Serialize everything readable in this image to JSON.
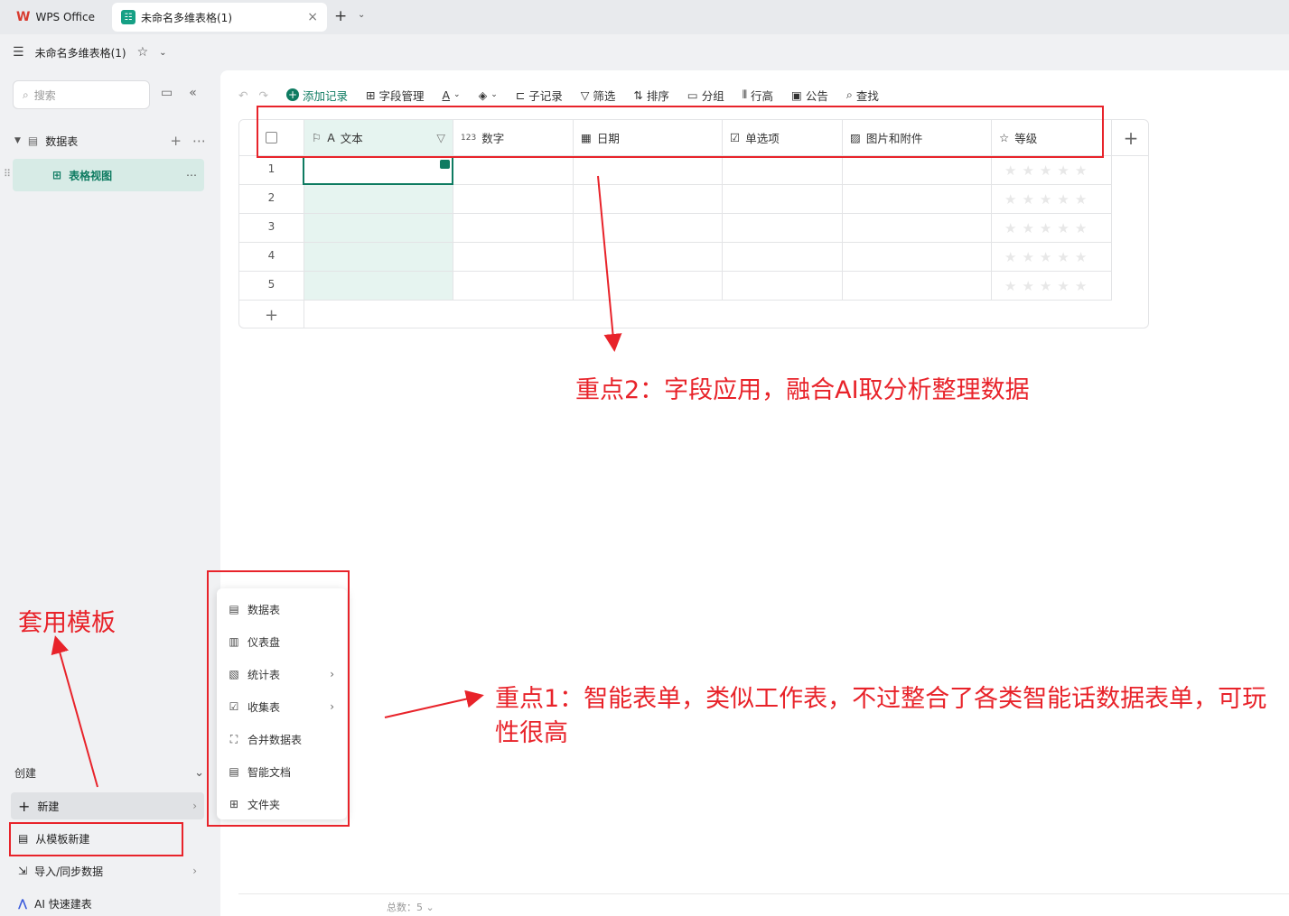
{
  "tabs": {
    "wps_label": "WPS Office",
    "doc_label": "未命名多维表格(1)"
  },
  "titlebar": {
    "doc_title": "未命名多维表格(1)"
  },
  "sidebar": {
    "search_placeholder": "搜索",
    "table_label": "数据表",
    "view_label": "表格视图",
    "create_label": "创建",
    "items": [
      {
        "label": "新建"
      },
      {
        "label": "从模板新建"
      },
      {
        "label": "导入/同步数据"
      },
      {
        "label": "AI 快速建表"
      }
    ]
  },
  "toolbar": {
    "add_record": "添加记录",
    "field_manage": "字段管理",
    "sub_record": "子记录",
    "filter": "筛选",
    "sort": "排序",
    "group": "分组",
    "row_height": "行高",
    "notice": "公告",
    "find": "查找"
  },
  "grid": {
    "columns": [
      {
        "icon_prefix": "A",
        "label": "文本"
      },
      {
        "icon_prefix": "123",
        "label": "数字"
      },
      {
        "icon_prefix": "cal",
        "label": "日期"
      },
      {
        "icon_prefix": "sel",
        "label": "单选项"
      },
      {
        "icon_prefix": "img",
        "label": "图片和附件"
      },
      {
        "icon_prefix": "star",
        "label": "等级"
      }
    ],
    "rows": [
      "1",
      "2",
      "3",
      "4",
      "5"
    ]
  },
  "footer": {
    "total": "总数：5"
  },
  "menu": {
    "items": [
      {
        "label": "数据表",
        "icon": "table-icon"
      },
      {
        "label": "仪表盘",
        "icon": "dashboard-icon"
      },
      {
        "label": "统计表",
        "icon": "stats-icon"
      },
      {
        "label": "收集表",
        "icon": "form-icon"
      },
      {
        "label": "合并数据表",
        "icon": "merge-icon"
      },
      {
        "label": "智能文档",
        "icon": "doc-icon"
      },
      {
        "label": "文件夹",
        "icon": "folder-icon"
      }
    ]
  },
  "annotations": {
    "note1": "重点1：智能表单，类似工作表，不过整合了各类智能话数据表单，可玩性很高",
    "note2": "重点2：字段应用，融合AI取分析整理数据",
    "note3": "套用模板"
  },
  "colors": {
    "accent": "#0e7b61",
    "annotation": "#e8232a"
  }
}
